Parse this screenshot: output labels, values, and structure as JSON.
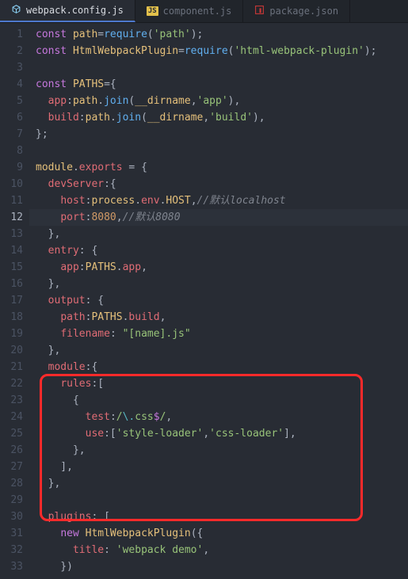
{
  "tabs": [
    {
      "label": "webpack.config.js",
      "icon": "webpack-icon",
      "active": true
    },
    {
      "label": "component.js",
      "icon": "js-icon",
      "active": false
    },
    {
      "label": "package.json",
      "icon": "npm-icon",
      "active": false
    }
  ],
  "cursorLine": 12,
  "highlightBox": {
    "startLine": 21,
    "endLine": 28
  },
  "code": {
    "lines": [
      [
        [
          "kw",
          "const"
        ],
        [
          "p",
          " "
        ],
        [
          "def",
          "path"
        ],
        [
          "p",
          "="
        ],
        [
          "fn",
          "require"
        ],
        [
          "p",
          "("
        ],
        [
          "str",
          "'path'"
        ],
        [
          "p",
          ");"
        ]
      ],
      [
        [
          "kw",
          "const"
        ],
        [
          "p",
          " "
        ],
        [
          "def",
          "HtmlWebpackPlugin"
        ],
        [
          "p",
          "="
        ],
        [
          "fn",
          "require"
        ],
        [
          "p",
          "("
        ],
        [
          "str",
          "'html-webpack-plugin'"
        ],
        [
          "p",
          ");"
        ]
      ],
      [],
      [
        [
          "kw",
          "const"
        ],
        [
          "p",
          " "
        ],
        [
          "def",
          "PATHS"
        ],
        [
          "p",
          "={"
        ]
      ],
      [
        [
          "p",
          "  "
        ],
        [
          "prop",
          "app"
        ],
        [
          "p",
          ":"
        ],
        [
          "bif",
          "path"
        ],
        [
          "p",
          "."
        ],
        [
          "fn",
          "join"
        ],
        [
          "p",
          "("
        ],
        [
          "bif",
          "__dirname"
        ],
        [
          "p",
          ","
        ],
        [
          "str",
          "'app'"
        ],
        [
          "p",
          "),"
        ]
      ],
      [
        [
          "p",
          "  "
        ],
        [
          "prop",
          "build"
        ],
        [
          "p",
          ":"
        ],
        [
          "bif",
          "path"
        ],
        [
          "p",
          "."
        ],
        [
          "fn",
          "join"
        ],
        [
          "p",
          "("
        ],
        [
          "bif",
          "__dirname"
        ],
        [
          "p",
          ","
        ],
        [
          "str",
          "'build'"
        ],
        [
          "p",
          "),"
        ]
      ],
      [
        [
          "p",
          "};"
        ]
      ],
      [],
      [
        [
          "bif",
          "module"
        ],
        [
          "p",
          "."
        ],
        [
          "prop",
          "exports"
        ],
        [
          "p",
          " = {"
        ]
      ],
      [
        [
          "p",
          "  "
        ],
        [
          "prop",
          "devServer"
        ],
        [
          "p",
          ":{"
        ]
      ],
      [
        [
          "p",
          "    "
        ],
        [
          "prop",
          "host"
        ],
        [
          "p",
          ":"
        ],
        [
          "bif",
          "process"
        ],
        [
          "p",
          "."
        ],
        [
          "prop",
          "env"
        ],
        [
          "p",
          "."
        ],
        [
          "def",
          "HOST"
        ],
        [
          "p",
          ","
        ],
        [
          "cmt",
          "//默认localhost"
        ]
      ],
      [
        [
          "p",
          "    "
        ],
        [
          "prop",
          "port"
        ],
        [
          "p",
          ":"
        ],
        [
          "num",
          "8080"
        ],
        [
          "p",
          ","
        ],
        [
          "cmt",
          "//默认8080"
        ]
      ],
      [
        [
          "p",
          "  },"
        ]
      ],
      [
        [
          "p",
          "  "
        ],
        [
          "prop",
          "entry"
        ],
        [
          "p",
          ": {"
        ]
      ],
      [
        [
          "p",
          "    "
        ],
        [
          "prop",
          "app"
        ],
        [
          "p",
          ":"
        ],
        [
          "def",
          "PATHS"
        ],
        [
          "p",
          "."
        ],
        [
          "prop",
          "app"
        ],
        [
          "p",
          ","
        ]
      ],
      [
        [
          "p",
          "  },"
        ]
      ],
      [
        [
          "p",
          "  "
        ],
        [
          "prop",
          "output"
        ],
        [
          "p",
          ": {"
        ]
      ],
      [
        [
          "p",
          "    "
        ],
        [
          "prop",
          "path"
        ],
        [
          "p",
          ":"
        ],
        [
          "def",
          "PATHS"
        ],
        [
          "p",
          "."
        ],
        [
          "prop",
          "build"
        ],
        [
          "p",
          ","
        ]
      ],
      [
        [
          "p",
          "    "
        ],
        [
          "prop",
          "filename"
        ],
        [
          "p",
          ": "
        ],
        [
          "str",
          "\"[name].js\""
        ]
      ],
      [
        [
          "p",
          "  },"
        ]
      ],
      [
        [
          "p",
          "  "
        ],
        [
          "prop",
          "module"
        ],
        [
          "p",
          ":{"
        ]
      ],
      [
        [
          "p",
          "    "
        ],
        [
          "prop",
          "rules"
        ],
        [
          "p",
          ":["
        ]
      ],
      [
        [
          "p",
          "      {"
        ]
      ],
      [
        [
          "p",
          "        "
        ],
        [
          "prop",
          "test"
        ],
        [
          "p",
          ":"
        ],
        [
          "regex",
          "/"
        ],
        [
          "regex-esc",
          "\\."
        ],
        [
          "regex",
          "css"
        ],
        [
          "regex-anchor",
          "$"
        ],
        [
          "regex",
          "/"
        ],
        [
          "p",
          ","
        ]
      ],
      [
        [
          "p",
          "        "
        ],
        [
          "prop",
          "use"
        ],
        [
          "p",
          ":["
        ],
        [
          "str",
          "'style-loader'"
        ],
        [
          "p",
          ","
        ],
        [
          "str",
          "'css-loader'"
        ],
        [
          "p",
          "],"
        ]
      ],
      [
        [
          "p",
          "      },"
        ]
      ],
      [
        [
          "p",
          "    ],"
        ]
      ],
      [
        [
          "p",
          "  },"
        ]
      ],
      [],
      [
        [
          "p",
          "  "
        ],
        [
          "prop",
          "plugins"
        ],
        [
          "p",
          ": ["
        ]
      ],
      [
        [
          "p",
          "    "
        ],
        [
          "kw",
          "new"
        ],
        [
          "p",
          " "
        ],
        [
          "def",
          "HtmlWebpackPlugin"
        ],
        [
          "p",
          "({"
        ]
      ],
      [
        [
          "p",
          "      "
        ],
        [
          "prop",
          "title"
        ],
        [
          "p",
          ": "
        ],
        [
          "str",
          "'webpack demo'"
        ],
        [
          "p",
          ","
        ]
      ],
      [
        [
          "p",
          "    })"
        ]
      ]
    ]
  }
}
